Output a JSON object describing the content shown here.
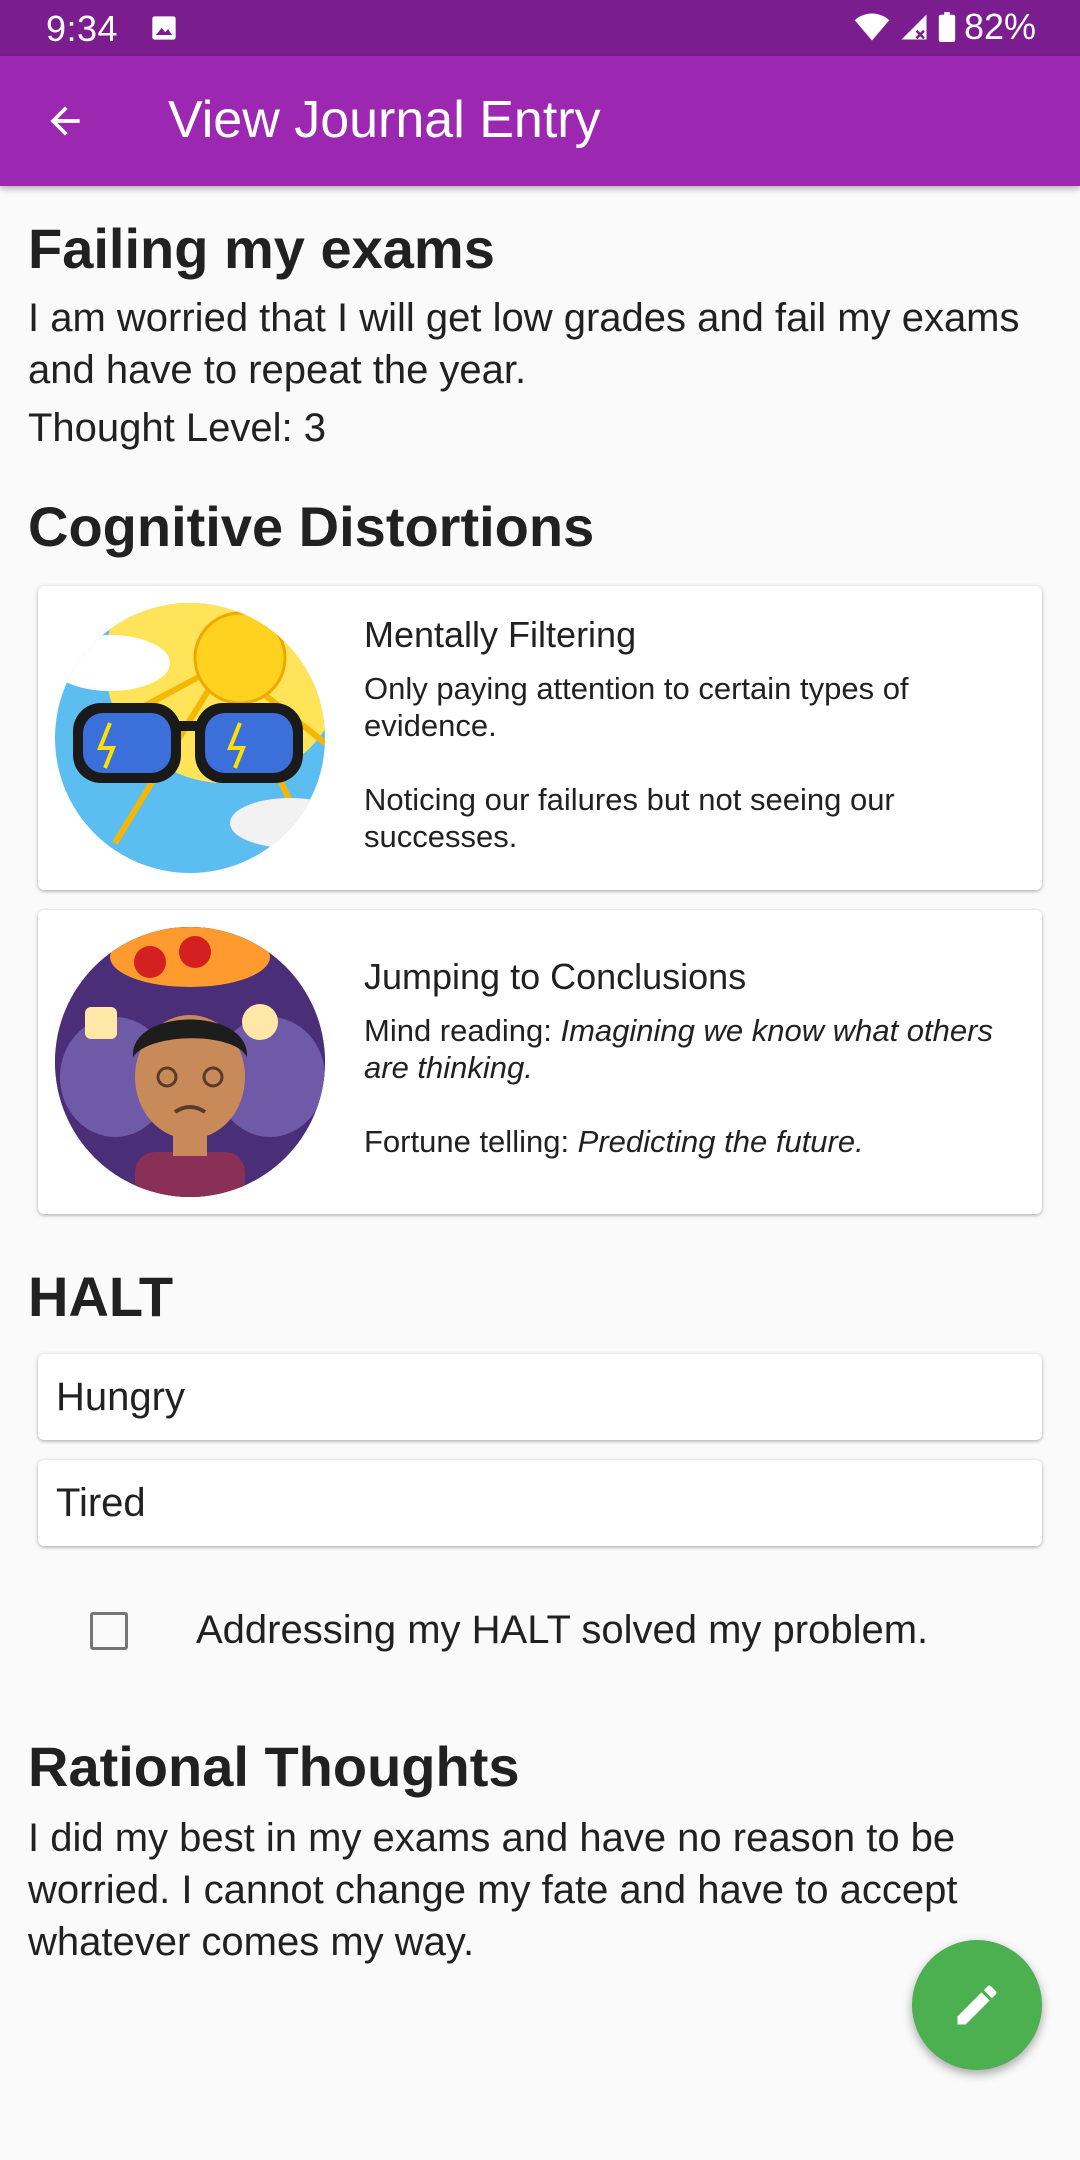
{
  "status_bar": {
    "time": "9:34",
    "battery": "82%"
  },
  "app_bar": {
    "title": "View Journal Entry"
  },
  "entry": {
    "title": "Failing my exams",
    "text": "I am worried that I will get low grades and fail my exams and have to repeat the year.",
    "thought_level": "Thought Level: 3"
  },
  "cognitive_distortions": {
    "heading": "Cognitive Distortions",
    "items": [
      {
        "title": "Mentally Filtering",
        "line1": "Only paying attention to certain types of evidence.",
        "line2": "Noticing our failures but not seeing our successes."
      },
      {
        "title": "Jumping to Conclusions",
        "line1_prefix": "Mind reading: ",
        "line1_italic": "Imagining we know what others are thinking.",
        "line2_prefix": "Fortune telling: ",
        "line2_italic": "Predicting the future."
      }
    ]
  },
  "halt": {
    "heading": "HALT",
    "items": [
      "Hungry",
      "Tired"
    ],
    "checkbox_label": "Addressing my HALT solved my problem.",
    "checked": false
  },
  "rational_thoughts": {
    "heading": "Rational Thoughts",
    "text": "I did my best in my exams and have no reason to be worried. I cannot change my fate and have to accept whatever comes my way."
  },
  "colors": {
    "status_bar": "#7b1d8e",
    "app_bar": "#9c27b0",
    "fab": "#4caf50"
  },
  "icons": {
    "back": "arrow-back-icon",
    "edit": "pencil-icon",
    "wifi": "wifi-icon",
    "signal": "signal-icon",
    "battery": "battery-icon",
    "image": "image-icon"
  }
}
